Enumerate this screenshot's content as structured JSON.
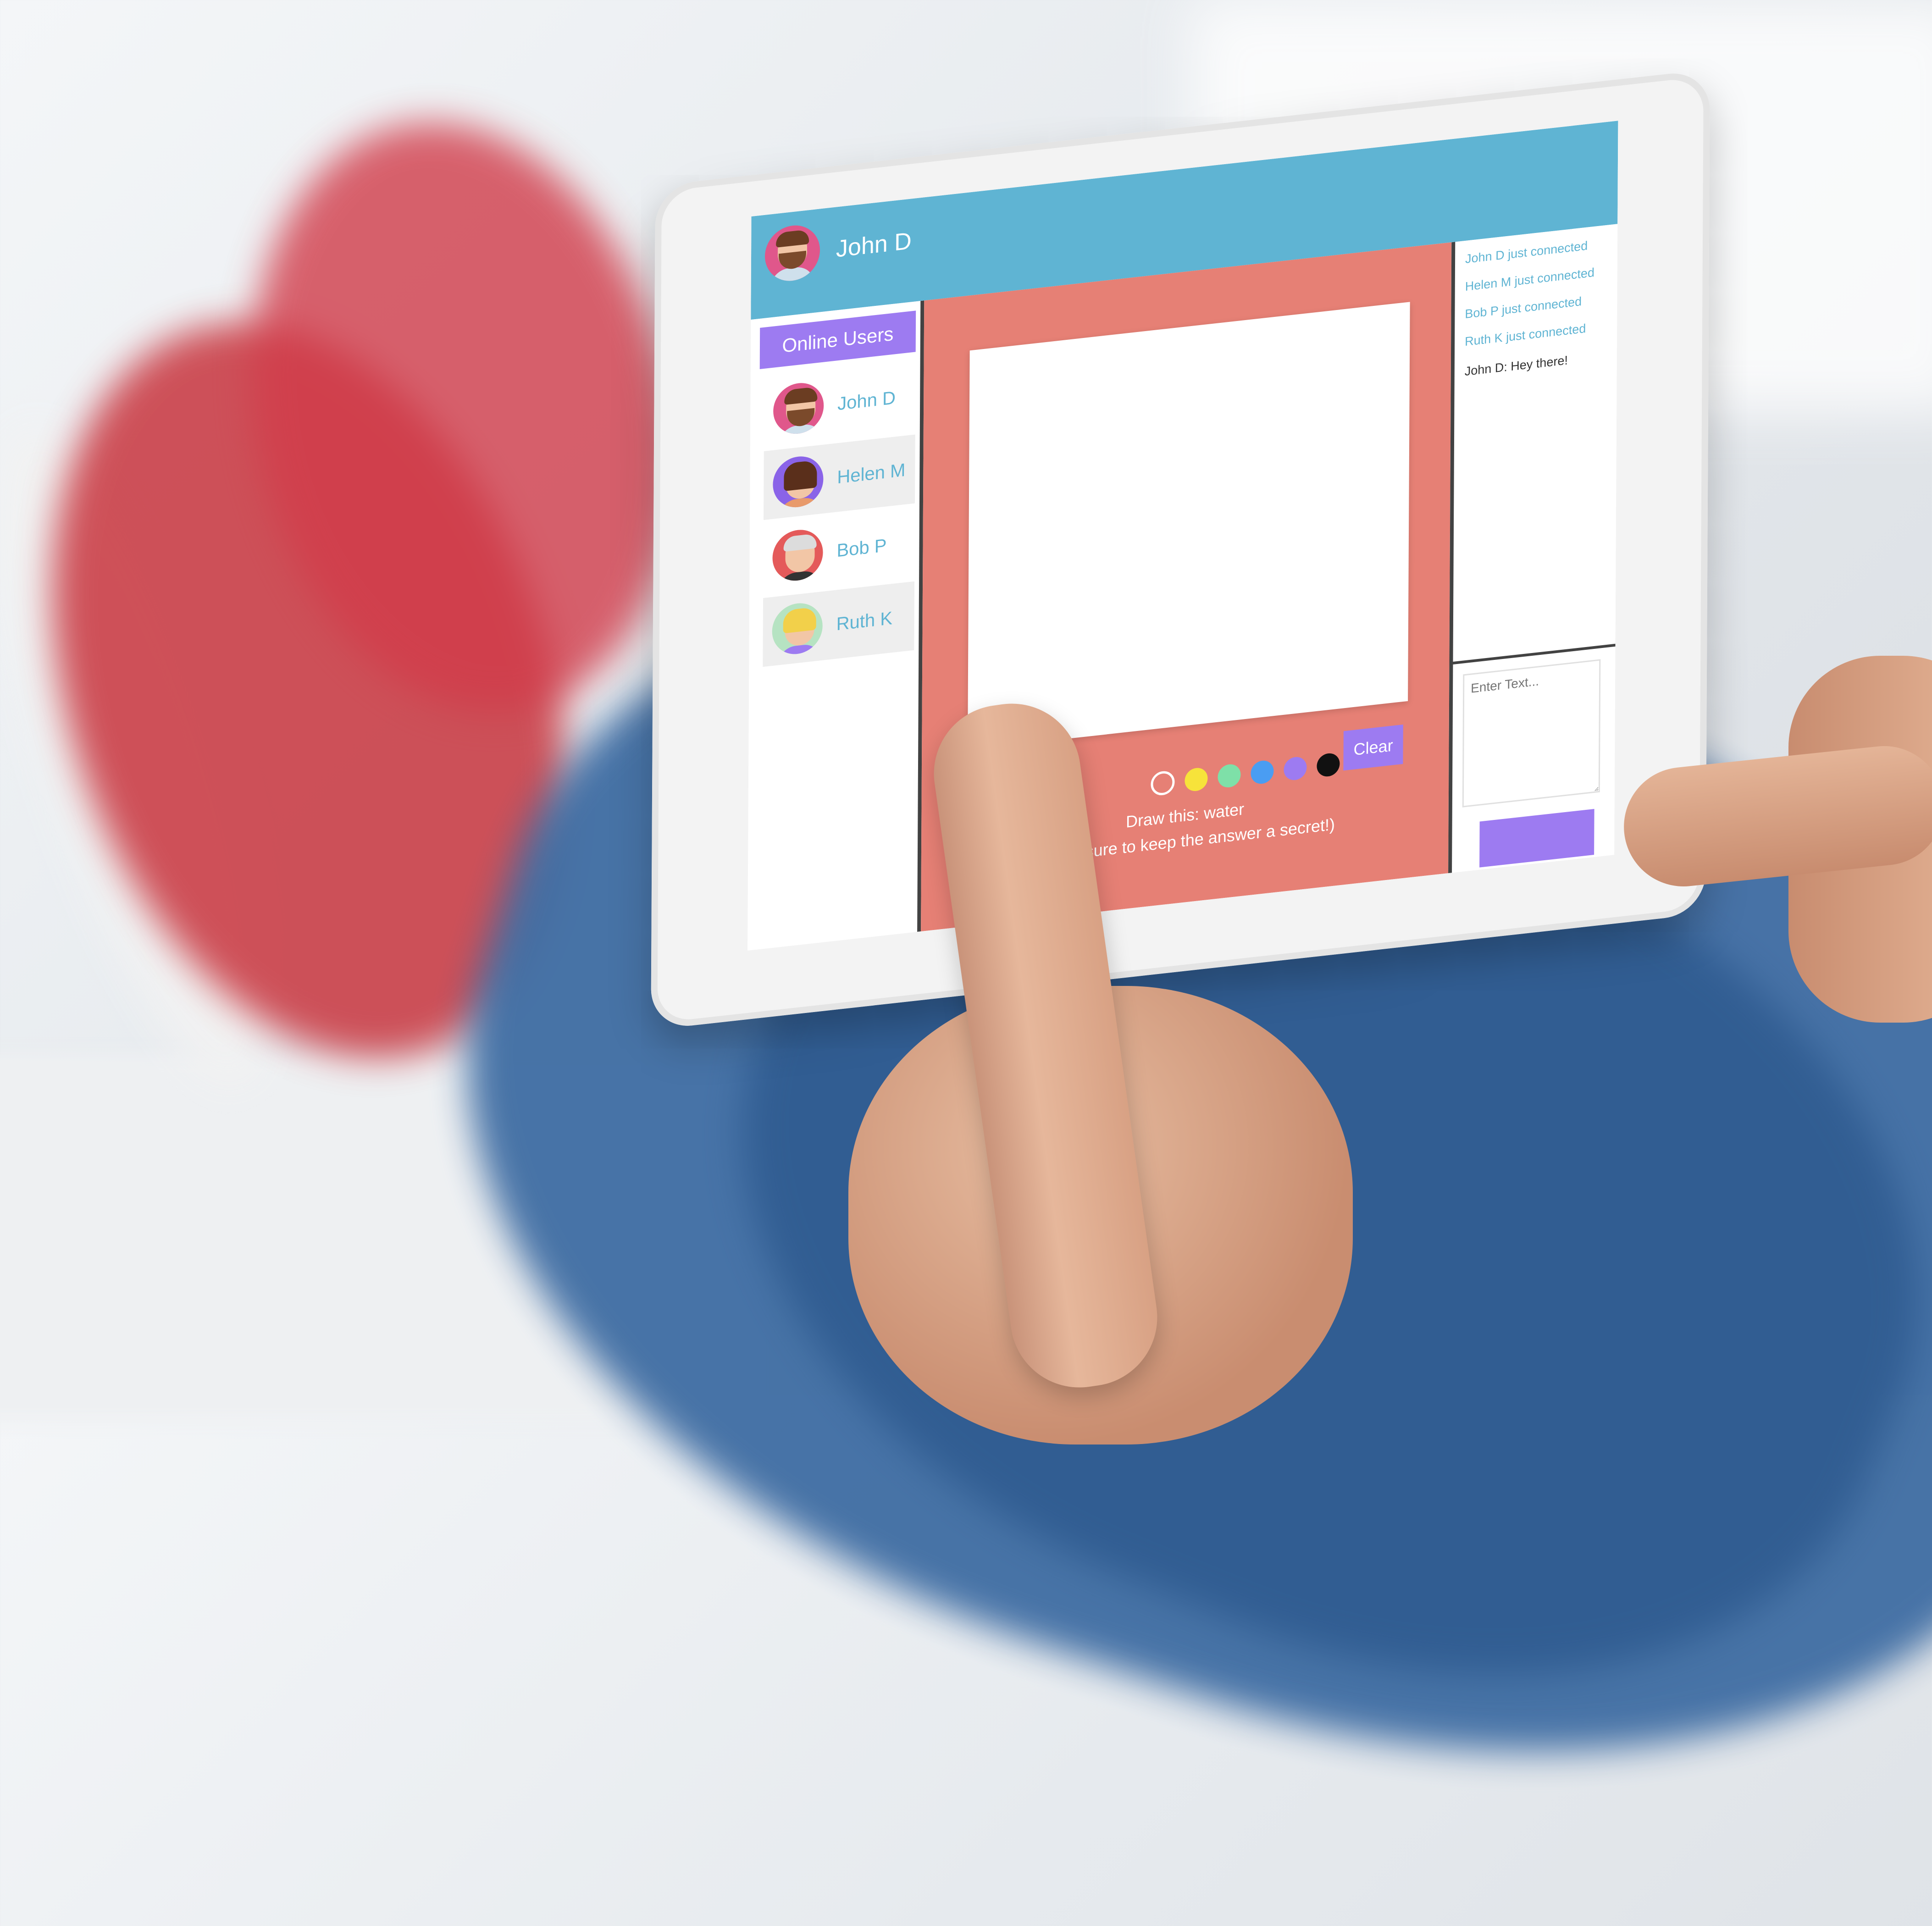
{
  "header": {
    "username": "John D"
  },
  "sidebar": {
    "title": "Online Users",
    "users": [
      {
        "name": "John D",
        "avatar_color": "#e0578b"
      },
      {
        "name": "Helen M",
        "avatar_color": "#8a63e8"
      },
      {
        "name": "Bob P",
        "avatar_color": "#e45a5a"
      },
      {
        "name": "Ruth K",
        "avatar_color": "#b6e3c2"
      }
    ]
  },
  "canvas": {
    "colors": [
      "#e68075",
      "#f7e33a",
      "#7ee0a8",
      "#4a9df2",
      "#9d7bf1",
      "#111111"
    ],
    "clear_label": "Clear",
    "prompt": "Draw this: water",
    "hint": "(Make sure to keep the answer a secret!)"
  },
  "chat": {
    "messages": [
      {
        "text": "John D just connected",
        "kind": "system"
      },
      {
        "text": "Helen M just connected",
        "kind": "system"
      },
      {
        "text": "Bob P just connected",
        "kind": "system"
      },
      {
        "text": "Ruth K just connected",
        "kind": "system"
      },
      {
        "text": "John D: Hey there!",
        "kind": "user"
      }
    ],
    "input_placeholder": "Enter Text..."
  },
  "theme": {
    "header_bg": "#5fb4d3",
    "accent": "#9d7bf1",
    "canvas_bg": "#e68075"
  }
}
